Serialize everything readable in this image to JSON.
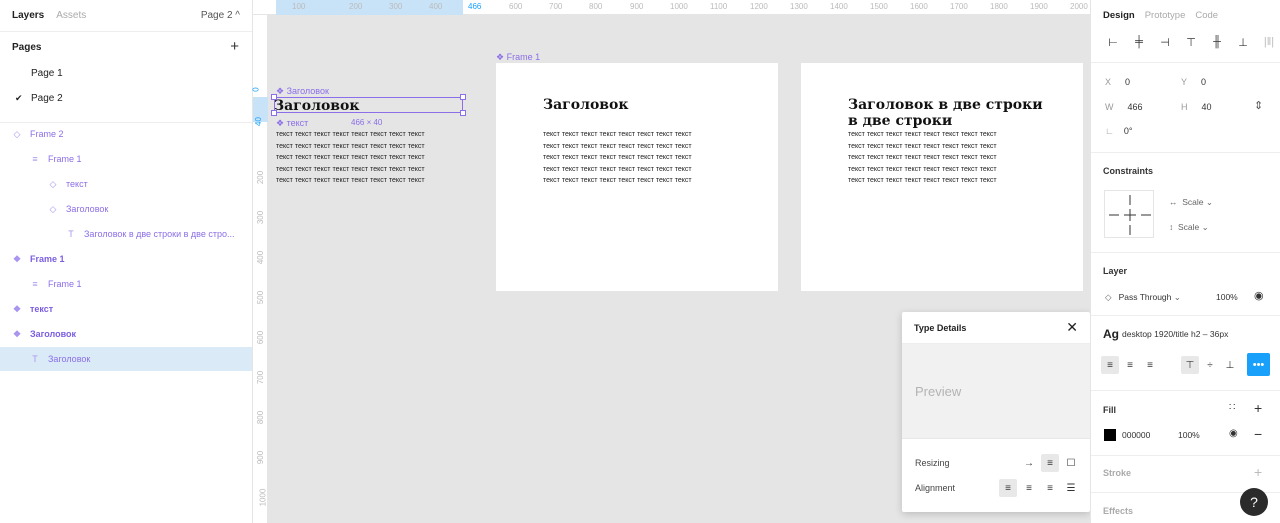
{
  "left_panel": {
    "tabs": [
      "Layers",
      "Assets"
    ],
    "current_page": "Page 2 ^",
    "pages_title": "Pages",
    "pages": [
      "Page 1",
      "Page 2"
    ],
    "layers": [
      {
        "label": "Frame 2",
        "icon": "◇",
        "indent": 1,
        "bold": false,
        "selected": false
      },
      {
        "label": "Frame 1",
        "icon": "≡",
        "indent": 2,
        "bold": false,
        "selected": false
      },
      {
        "label": "текст",
        "icon": "◇",
        "indent": 3,
        "bold": false,
        "selected": false
      },
      {
        "label": "Заголовок",
        "icon": "◇",
        "indent": 3,
        "bold": false,
        "selected": false
      },
      {
        "label": "Заголовок в две строки в две стро...",
        "icon": "T",
        "indent": 4,
        "bold": false,
        "selected": false
      },
      {
        "label": "Frame 1",
        "icon": "❖",
        "indent": 1,
        "bold": true,
        "selected": false
      },
      {
        "label": "Frame 1",
        "icon": "≡",
        "indent": 2,
        "bold": false,
        "selected": false
      },
      {
        "label": "текст",
        "icon": "❖",
        "indent": 1,
        "bold": true,
        "selected": false
      },
      {
        "label": "Заголовок",
        "icon": "❖",
        "indent": 1,
        "bold": true,
        "selected": false
      },
      {
        "label": "Заголовок",
        "icon": "T",
        "indent": 2,
        "bold": false,
        "selected": true
      }
    ]
  },
  "rulers": {
    "top_ticks": [
      "100",
      "200",
      "300",
      "400",
      "466",
      "600",
      "700",
      "800",
      "900",
      "1000",
      "1100",
      "1200",
      "1300",
      "1400",
      "1500",
      "1600",
      "1700",
      "1800",
      "1900",
      "2000"
    ],
    "left_ticks": [
      "0",
      "40",
      "200",
      "300",
      "400",
      "500",
      "600",
      "700",
      "800",
      "900",
      "1000"
    ]
  },
  "canvas": {
    "frame_label": "Frame 1",
    "sel_label_title": "Заголовок",
    "sel_label_text": "текст",
    "size_label": "466 × 40",
    "heading": "Заголовок",
    "heading_two_line": "Заголовок в две строки\nв две строки",
    "body_text": "текст текст текст текст текст текст текст текст\nтекст текст текст текст текст текст текст текст\nтекст текст текст текст текст текст текст текст\nтекст текст текст текст текст текст текст текст\nтекст текст текст текст текст текст текст текст"
  },
  "type_details": {
    "title": "Type Details",
    "preview": "Preview",
    "resizing_label": "Resizing",
    "alignment_label": "Alignment"
  },
  "right_panel": {
    "tabs": [
      "Design",
      "Prototype",
      "Code"
    ],
    "x": "0",
    "y": "0",
    "w": "466",
    "h": "40",
    "rotation": "0°",
    "constraints_title": "Constraints",
    "constraint_h": "Scale",
    "constraint_v": "Scale",
    "layer_title": "Layer",
    "blend_mode": "Pass Through",
    "layer_opacity": "100%",
    "text_style": "desktop 1920/title h2 – 36px",
    "fill_title": "Fill",
    "fill_hex": "000000",
    "fill_opacity": "100%",
    "stroke_title": "Stroke",
    "effects_title": "Effects"
  },
  "colors": {
    "accent": "#18a0fb",
    "component": "#8b6ee8",
    "selection": "#daebf7"
  }
}
